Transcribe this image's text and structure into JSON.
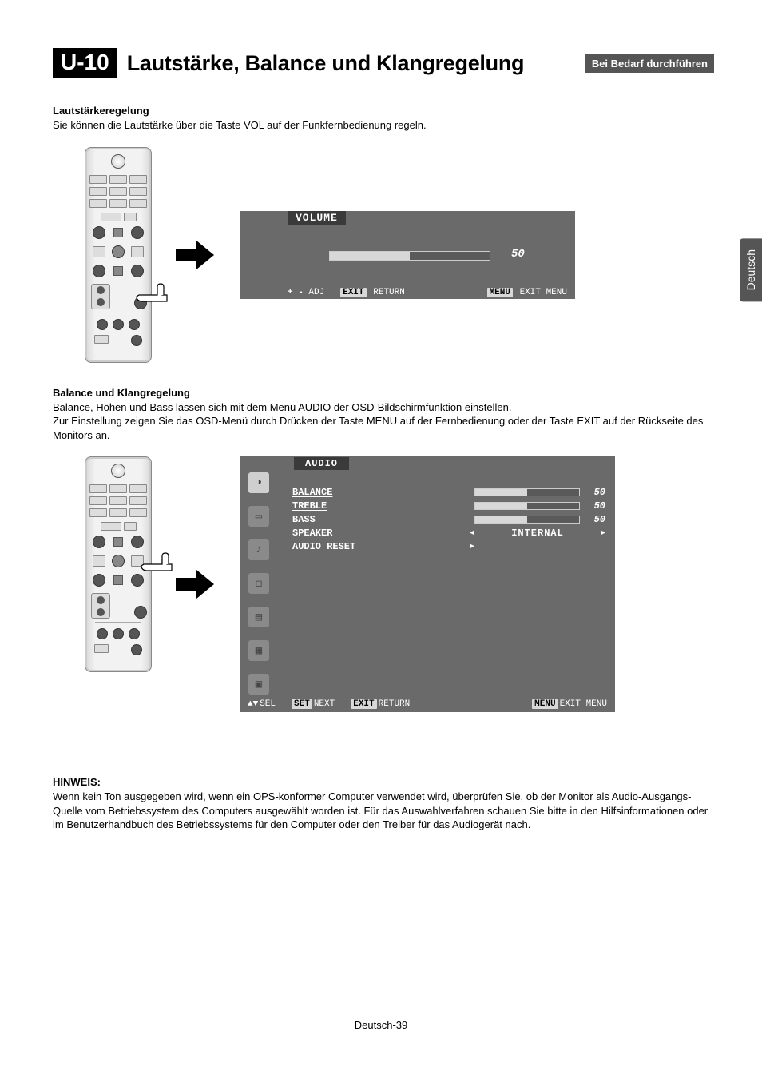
{
  "header": {
    "section_number": "U-10",
    "section_title": "Lautstärke, Balance und Klangregelung",
    "section_flag": "Bei Bedarf durchführen"
  },
  "sec1": {
    "heading": "Lautstärkeregelung",
    "body": "Sie können die Lautstärke über die Taste VOL auf der Funkfernbedienung regeln."
  },
  "osd_volume": {
    "title": "VOLUME",
    "value": "50",
    "footer_adj_pre": "+ -",
    "footer_adj": "ADJ",
    "footer_exit_pill": "EXIT",
    "footer_exit": "RETURN",
    "footer_menu_pill": "MENU",
    "footer_menu": "EXIT MENU"
  },
  "sec2": {
    "heading": "Balance und Klangregelung",
    "body": "Balance, Höhen und Bass lassen sich mit dem Menü AUDIO der OSD-Bildschirmfunktion einstellen.\nZur Einstellung zeigen Sie das OSD-Menü durch Drücken der Taste MENU auf der Fernbedienung oder der Taste EXIT auf der Rückseite des Monitors an."
  },
  "osd_audio": {
    "title": "AUDIO",
    "rows": {
      "balance": {
        "label": "BALANCE",
        "value": "50"
      },
      "treble": {
        "label": "TREBLE",
        "value": "50"
      },
      "bass": {
        "label": "BASS",
        "value": "50"
      },
      "speaker": {
        "label": "SPEAKER",
        "value": "INTERNAL"
      },
      "reset": {
        "label": "AUDIO RESET"
      }
    },
    "footer": {
      "sel_pre": "▲▼",
      "sel": "SEL",
      "set_pill": "SET",
      "set": "NEXT",
      "exit_pill": "EXIT",
      "exit": "RETURN",
      "menu_pill": "MENU",
      "menu": "EXIT MENU"
    }
  },
  "hint": {
    "heading": "HINWEIS:",
    "body": "Wenn kein Ton ausgegeben wird, wenn ein OPS-konformer Computer verwendet wird, überprüfen Sie, ob der Monitor als Audio-Ausgangs-Quelle vom Betriebssystem des Computers ausgewählt worden ist. Für das Auswahlverfahren schauen Sie bitte in den Hilfsinformationen oder im Benutzerhandbuch des Betriebssystems für den Computer oder den Treiber für das Audiogerät nach."
  },
  "language_tab": "Deutsch",
  "page_number": "Deutsch-39"
}
